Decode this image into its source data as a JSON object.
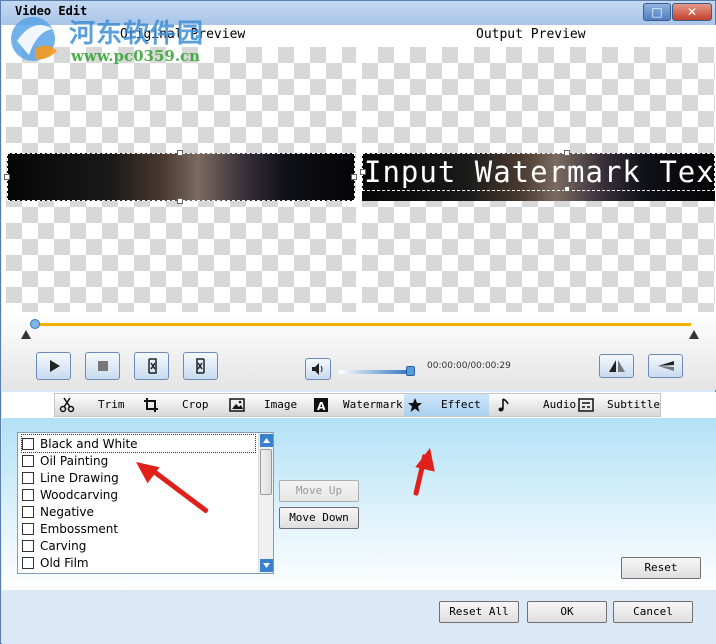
{
  "window": {
    "title": "Video Edit"
  },
  "watermark_logo": {
    "text": "河东软件园",
    "url": "www.pc0359.cn"
  },
  "preview": {
    "original_label": "Original Preview",
    "output_label": "Output Preview",
    "watermark_text": "Input Watermark Text"
  },
  "player": {
    "time": "00:00:00/00:00:29"
  },
  "tabs": [
    {
      "label": "Trim",
      "icon": "scissors-icon"
    },
    {
      "label": "Crop",
      "icon": "crop-icon"
    },
    {
      "label": "Image",
      "icon": "image-icon"
    },
    {
      "label": "Watermark",
      "icon": "watermark-icon"
    },
    {
      "label": "Effect",
      "icon": "star-icon",
      "active": true
    },
    {
      "label": "Audio",
      "icon": "music-note-icon"
    },
    {
      "label": "Subtitle",
      "icon": "subtitle-icon"
    }
  ],
  "effects": {
    "items": [
      "Black and White",
      "Oil Painting",
      "Line Drawing",
      "Woodcarving",
      "Negative",
      "Embossment",
      "Carving",
      "Old Film"
    ],
    "move_up_label": "Move Up",
    "move_down_label": "Move Down",
    "reset_label": "Reset"
  },
  "footer": {
    "reset_all_label": "Reset All",
    "ok_label": "OK",
    "cancel_label": "Cancel"
  },
  "colors": {
    "accent": "#f2b300",
    "annotation": "#e0201a",
    "panel": "#b3e1f6"
  }
}
